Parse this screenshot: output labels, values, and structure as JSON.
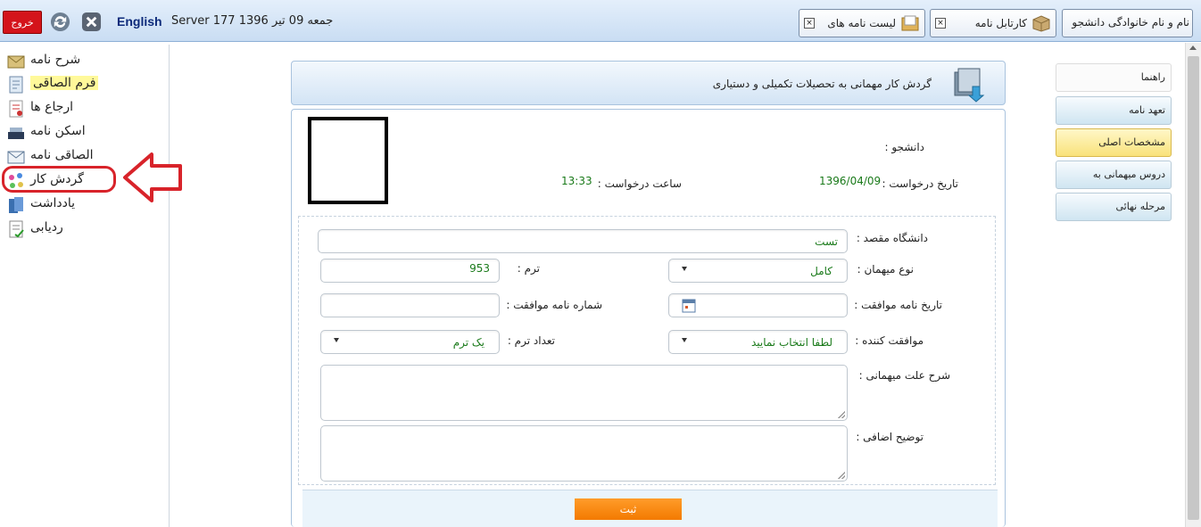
{
  "topbar": {
    "exit_label": "خروج",
    "language_label": "English",
    "server_info": "Server 177 1396 جمعه 09 تیر",
    "tabs": [
      {
        "label": "لیست نامه های"
      },
      {
        "label": "کارتابل نامه"
      }
    ],
    "user_tab_label": "نام و نام خانوادگی دانشجو"
  },
  "sidebar": {
    "items": [
      {
        "label": "شرح نامه",
        "icon": "letter-icon"
      },
      {
        "label": "فرم الصاقی",
        "icon": "form-icon"
      },
      {
        "label": "ارجاع ها",
        "icon": "referral-icon"
      },
      {
        "label": "اسکن نامه",
        "icon": "scanner-icon"
      },
      {
        "label": "الصاقی نامه",
        "icon": "envelope-icon"
      },
      {
        "label": "گردش کار",
        "icon": "workflow-icon"
      },
      {
        "label": "یادداشت",
        "icon": "notes-icon"
      },
      {
        "label": "ردیابی",
        "icon": "tracking-icon"
      }
    ]
  },
  "header": {
    "title": "گردش کار مهمانی به تحصیلات تکمیلی و دستیاری"
  },
  "info": {
    "student_label": "دانشجو :",
    "request_date_label": "تاریخ درخواست :",
    "request_date_value": "1396/04/09",
    "request_time_label": "ساعت درخواست :",
    "request_time_value": "13:33"
  },
  "form": {
    "dest_university_label": "دانشگاه مقصد :",
    "dest_university_value": "تست",
    "guest_type_label": "نوع میهمان :",
    "guest_type_value": "کامل",
    "term_label": "ترم :",
    "term_value": "953",
    "approval_date_label": "تاریخ نامه موافقت :",
    "approval_number_label": "شماره نامه موافقت :",
    "approver_label": "موافقت کننده :",
    "approver_value": "لطفا انتخاب نمایید",
    "term_count_label": "تعداد ترم :",
    "term_count_value": "یک ترم",
    "reason_label": "شرح علت میهمانی :",
    "extra_desc_label": "توضیح اضافی :",
    "submit_label": "ثبت"
  },
  "right_tabs": [
    {
      "label": "راهنما"
    },
    {
      "label": "تعهد نامه"
    },
    {
      "label": "مشخصات اصلی"
    },
    {
      "label": "دروس میهمانی به"
    },
    {
      "label": "مرحله نهائی"
    }
  ],
  "colors": {
    "exit_red": "#d4141b",
    "highlight_yellow": "#fff99a",
    "annotation_red": "#d8232a",
    "submit_orange": "#f37a00",
    "value_green": "#1a7a1a"
  }
}
